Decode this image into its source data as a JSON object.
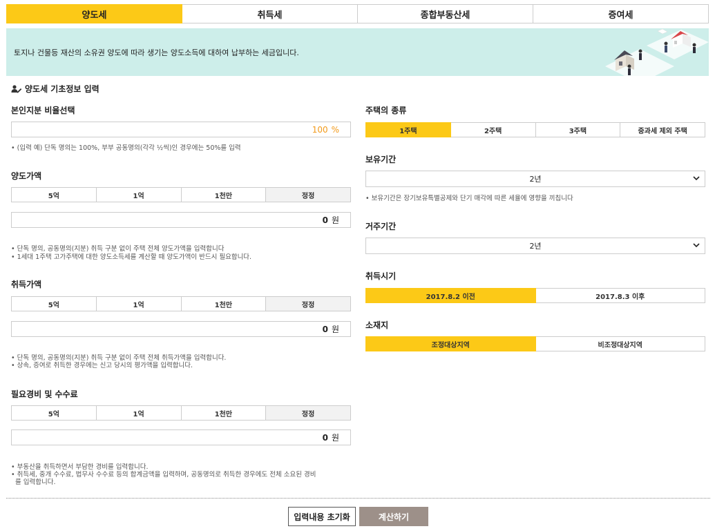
{
  "tabs": [
    {
      "label": "양도세",
      "active": true
    },
    {
      "label": "취득세",
      "active": false
    },
    {
      "label": "종합부동산세",
      "active": false
    },
    {
      "label": "증여세",
      "active": false
    }
  ],
  "banner": {
    "text": "토지나 건물등 재산의 소유권 양도에 따라 생기는 양도소득에 대하여 납부하는 세금입니다."
  },
  "section_title": "양도세 기초정보 입력",
  "ownership": {
    "label": "본인지분 비율선택",
    "value": "100",
    "unit": "%",
    "note": "• (입력 예) 단독 명의는 100%, 부부 공동명의(각각 ½씩)인 경우에는 50%를 입력"
  },
  "amount_buttons": [
    "5억",
    "1억",
    "1천만",
    "정정"
  ],
  "sale_price": {
    "label": "양도가액",
    "value": "0",
    "unit": "원",
    "notes": [
      "• 단독 명의, 공동명의(지분) 취득 구분 없이 주택 전체 양도가액을 입력합니다",
      "• 1세대 1주택 고가주택에 대한 양도소득세를 계산할 때 양도가액이 반드시 필요합니다."
    ]
  },
  "acquisition_price": {
    "label": "취득가액",
    "value": "0",
    "unit": "원",
    "notes": [
      "• 단독 명의, 공동명의(지분) 취득 구분 없이 주택 전체 취득가액을 입력합니다.",
      "• 상속, 증여로 취득한 경우에는 신고 당시의 평가액을 입력합니다."
    ]
  },
  "expenses": {
    "label": "필요경비 및 수수료",
    "value": "0",
    "unit": "원",
    "notes": [
      "• 부동산을 취득하면서 부담한 경비를 입력합니다.",
      "• 취득세, 중개 수수료, 법무사 수수료 등의 합계금액을 입력하며, 공동명의로 취득한 경우에도 전체 소요된 경비",
      "  를 입력합니다."
    ]
  },
  "house_type": {
    "label": "주택의 종류",
    "options": [
      "1주택",
      "2주택",
      "3주택",
      "중과세 제외 주택"
    ],
    "selected": 0
  },
  "holding_period": {
    "label": "보유기간",
    "value": "2년",
    "note": "• 보유기간은 장기보유특별공제와 단기 매각에 따른 세율에 영향을 끼칩니다"
  },
  "residence_period": {
    "label": "거주기간",
    "value": "2년"
  },
  "acquisition_time": {
    "label": "취득시기",
    "options": [
      "2017.8.2 이전",
      "2017.8.3 이후"
    ],
    "selected": 0
  },
  "location": {
    "label": "소재지",
    "options": [
      "조정대상지역",
      "비조정대상지역"
    ],
    "selected": 0
  },
  "actions": {
    "reset": "입력내용 초기화",
    "calculate": "계산하기"
  },
  "colors": {
    "accent": "#fcc917",
    "banner_bg": "#cdeeea",
    "calc_btn": "#9d9089",
    "percent": "#f29a1a"
  }
}
